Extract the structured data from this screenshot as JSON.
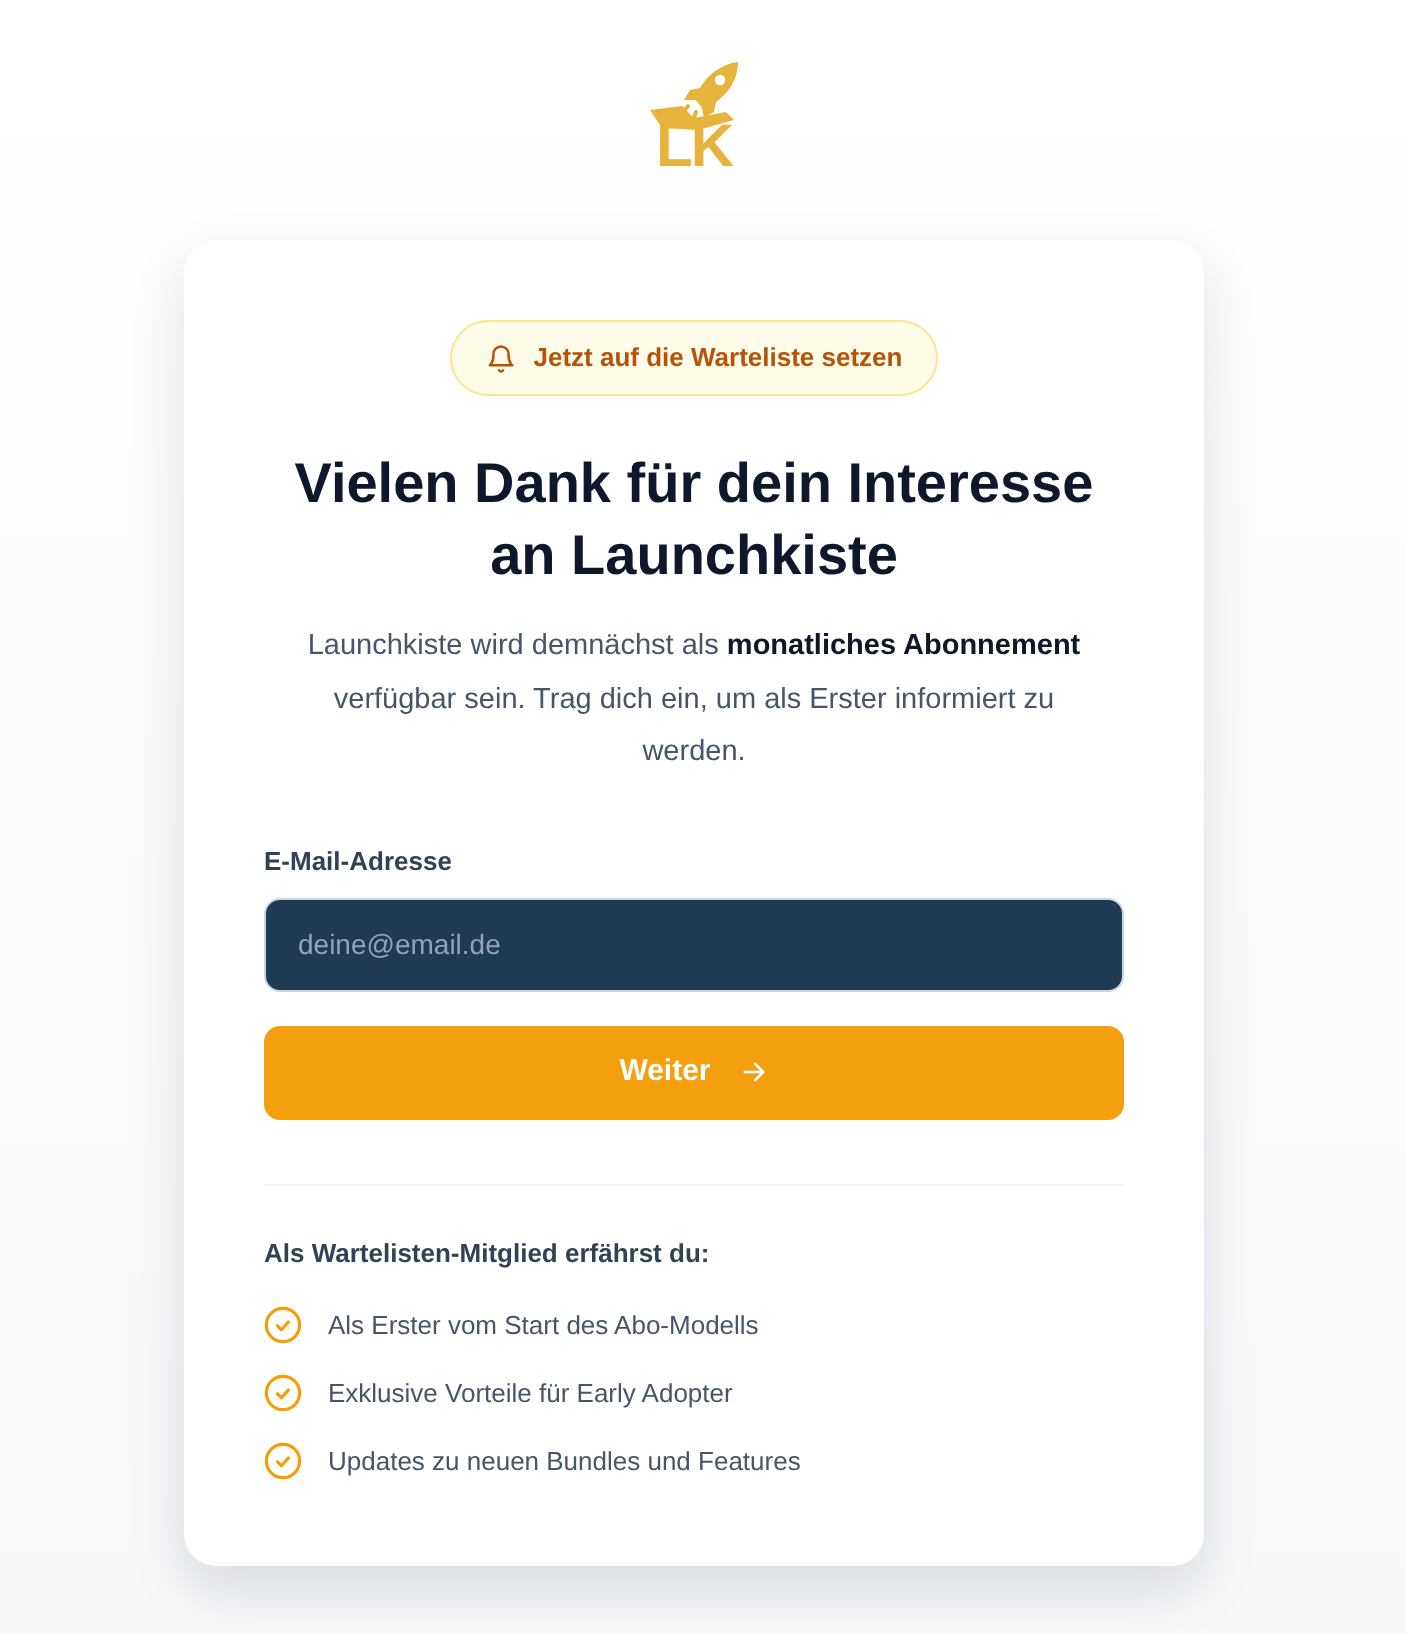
{
  "logo": {
    "text": "LK"
  },
  "card": {
    "badge": {
      "label": "Jetzt auf die Warteliste setzen"
    },
    "heading": "Vielen Dank für dein Interesse an Launchkiste",
    "intro": "Launchkiste wird demnächst als **monatliches Abonnement** verfügbar sein. Trag dich ein, um als Erster informiert zu werden.",
    "email_field": {
      "label": "E-Mail-Adresse",
      "placeholder": "deine@email.de"
    },
    "submit_button": {
      "label": "Weiter"
    },
    "benefits": {
      "title": "Als Wartelisten-Mitglied erfährst du:",
      "items": [
        "Als Erster vom Start des Abo-Modells",
        "Exklusive Vorteile für Early Adopter",
        "Updates zu neuen Bundles und Features"
      ]
    }
  }
}
